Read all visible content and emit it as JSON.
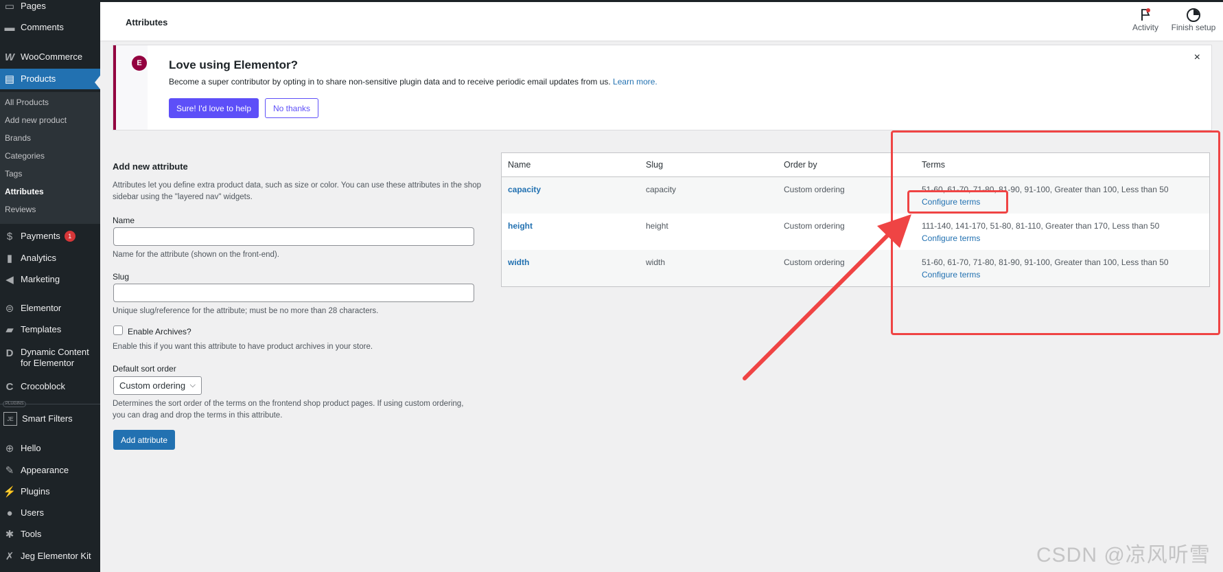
{
  "sidebar": {
    "items": [
      {
        "label": "Pages",
        "icon": "pages-icon"
      },
      {
        "label": "Comments",
        "icon": "comments-icon"
      },
      {
        "label": "WooCommerce",
        "icon": "woocommerce-icon"
      },
      {
        "label": "Products",
        "icon": "products-icon"
      },
      {
        "label": "Payments",
        "icon": "payments-icon",
        "badge": "1"
      },
      {
        "label": "Analytics",
        "icon": "analytics-icon"
      },
      {
        "label": "Marketing",
        "icon": "marketing-icon"
      },
      {
        "label": "Elementor",
        "icon": "elementor-icon"
      },
      {
        "label": "Templates",
        "icon": "templates-icon"
      },
      {
        "label": "Dynamic Content",
        "label2": "for Elementor",
        "icon": "dynamic-content-icon"
      },
      {
        "label": "Crocoblock",
        "icon": "crocoblock-icon"
      },
      {
        "label": "Smart Filters",
        "icon": "smart-filters-icon"
      },
      {
        "label": "Hello",
        "icon": "hello-icon"
      },
      {
        "label": "Appearance",
        "icon": "appearance-icon"
      },
      {
        "label": "Plugins",
        "icon": "plugins-icon"
      },
      {
        "label": "Users",
        "icon": "users-icon"
      },
      {
        "label": "Tools",
        "icon": "tools-icon"
      },
      {
        "label": "Jeg Elementor Kit",
        "icon": "jeg-kit-icon"
      }
    ],
    "submenu": [
      "All Products",
      "Add new product",
      "Brands",
      "Categories",
      "Tags",
      "Attributes",
      "Reviews"
    ],
    "plugins_tag": "PLUGINS"
  },
  "topbar": {
    "title": "Attributes",
    "activity_label": "Activity",
    "finish_setup_label": "Finish setup"
  },
  "notice": {
    "title": "Love using Elementor?",
    "text": "Become a super contributor by opting in to share non-sensitive plugin data and to receive periodic email updates from us.",
    "link": "Learn more.",
    "primary_button": "Sure! I'd love to help",
    "secondary_button": "No thanks",
    "close": "×"
  },
  "form": {
    "heading": "Add new attribute",
    "intro": "Attributes let you define extra product data, such as size or color. You can use these attributes in the shop sidebar using the \"layered nav\" widgets.",
    "name_label": "Name",
    "name_value": "",
    "name_desc": "Name for the attribute (shown on the front-end).",
    "slug_label": "Slug",
    "slug_value": "",
    "slug_desc": "Unique slug/reference for the attribute; must be no more than 28 characters.",
    "archives_label": "Enable Archives?",
    "archives_checked": false,
    "archives_desc": "Enable this if you want this attribute to have product archives in your store.",
    "sort_label": "Default sort order",
    "sort_value": "Custom ordering",
    "sort_desc": "Determines the sort order of the terms on the frontend shop product pages. If using custom ordering, you can drag and drop the terms in this attribute.",
    "submit_label": "Add attribute"
  },
  "table": {
    "headers": [
      "Name",
      "Slug",
      "Order by",
      "Terms"
    ],
    "rows": [
      {
        "name": "capacity",
        "slug": "capacity",
        "order": "Custom ordering",
        "terms": "51-60, 61-70, 71-80, 81-90, 91-100, Greater than 100, Less than 50",
        "configure": "Configure terms"
      },
      {
        "name": "height",
        "slug": "height",
        "order": "Custom ordering",
        "terms": "111-140, 141-170, 51-80, 81-110, Greater than 170, Less than 50",
        "configure": "Configure terms"
      },
      {
        "name": "width",
        "slug": "width",
        "order": "Custom ordering",
        "terms": "51-60, 61-70, 71-80, 81-90, 91-100, Greater than 100, Less than 50",
        "configure": "Configure terms"
      }
    ]
  },
  "watermark": "CSDN @凉风听雪",
  "colors": {
    "accent": "#2271b1",
    "sidebar": "#1d2327",
    "annotation": "#ef4444",
    "elementor": "#93003f",
    "notice_button": "#5d4ff8"
  }
}
